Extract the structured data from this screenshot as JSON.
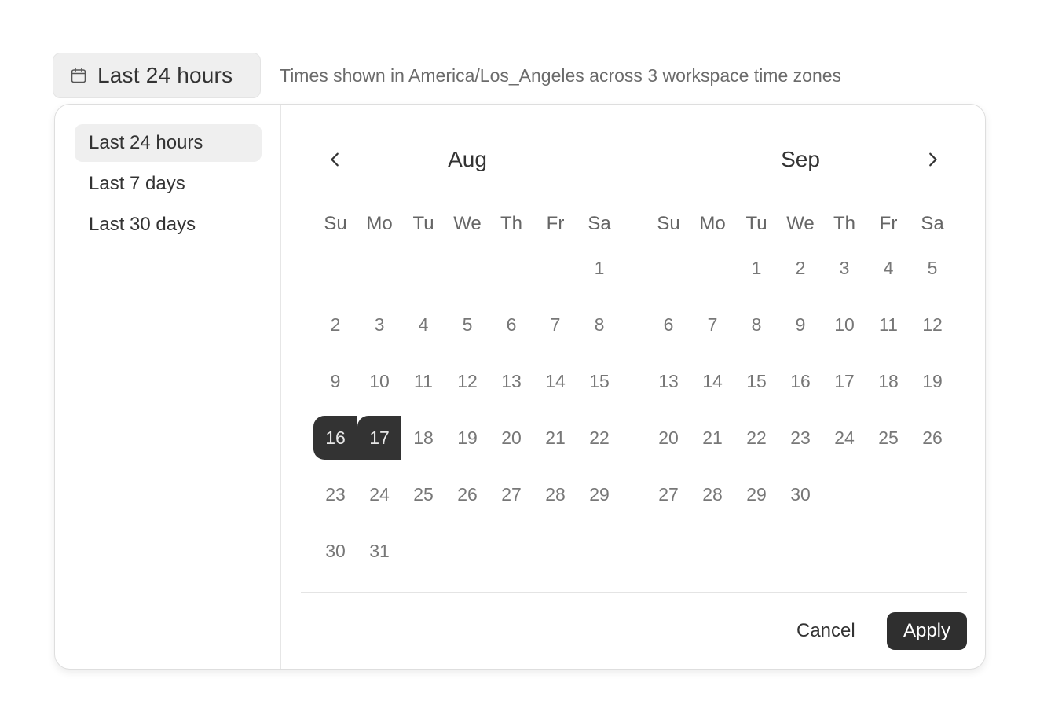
{
  "trigger": {
    "label": "Last 24 hours",
    "icon": "calendar-icon"
  },
  "hint": "Times shown in America/Los_Angeles across 3 workspace time zones",
  "presets": [
    {
      "label": "Last 24 hours",
      "active": true
    },
    {
      "label": "Last 7 days",
      "active": false
    },
    {
      "label": "Last 30 days",
      "active": false
    }
  ],
  "weekdays": [
    "Su",
    "Mo",
    "Tu",
    "We",
    "Th",
    "Fr",
    "Sa"
  ],
  "nav": {
    "prev_icon": "chevron-left-icon",
    "next_icon": "chevron-right-icon"
  },
  "months": [
    {
      "name": "Aug",
      "first_weekday": 6,
      "days": 31,
      "selected": [
        16,
        17
      ]
    },
    {
      "name": "Sep",
      "first_weekday": 2,
      "days": 30,
      "selected": []
    }
  ],
  "actions": {
    "cancel": "Cancel",
    "apply": "Apply"
  },
  "colors": {
    "selected_bg": "#333333",
    "apply_bg": "#2f2f2f",
    "preset_active_bg": "#efefef"
  }
}
